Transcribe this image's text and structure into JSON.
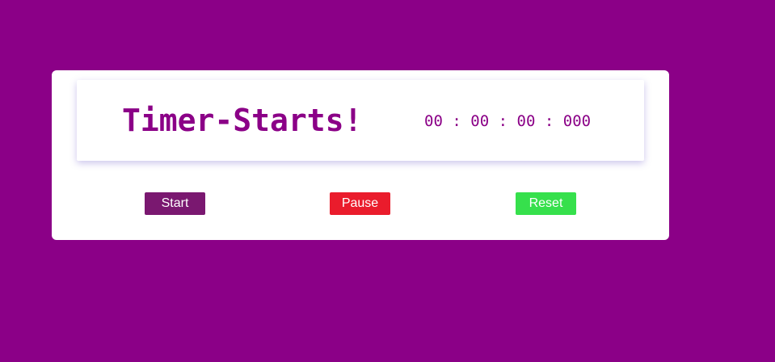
{
  "timer": {
    "title": "Timer-Starts!",
    "clock": {
      "hours": "00",
      "minutes": "00",
      "seconds": "00",
      "milliseconds": "000",
      "separator": ":"
    }
  },
  "controls": {
    "start_label": "Start",
    "pause_label": "Pause",
    "reset_label": "Reset"
  },
  "colors": {
    "background": "#8b0087",
    "accent_text": "#8b0087",
    "start_button": "#7a1870",
    "pause_button": "#ea1c2c",
    "reset_button": "#36e04c"
  }
}
